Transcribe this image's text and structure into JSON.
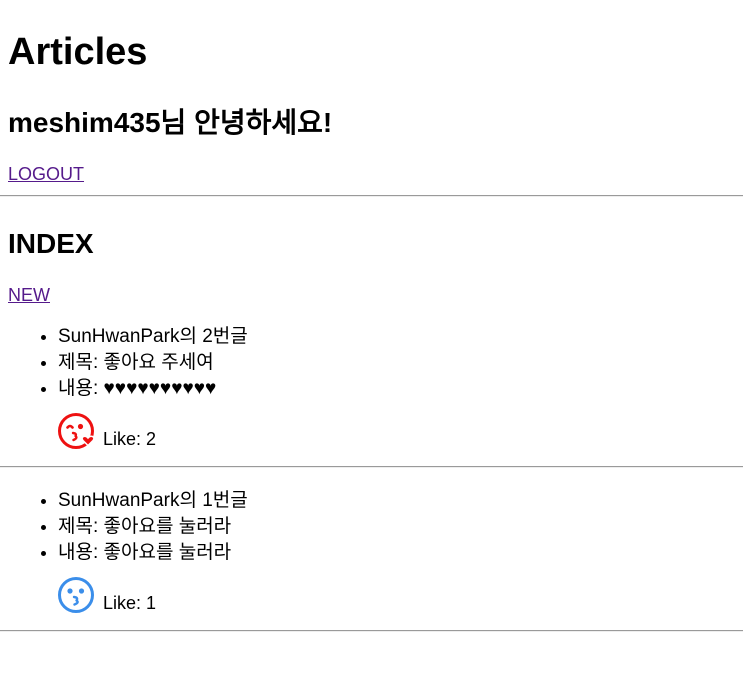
{
  "page": {
    "heading": "Articles"
  },
  "user": {
    "greeting": "meshim435님 안녕하세요!",
    "logout_label": "LOGOUT"
  },
  "index": {
    "title": "INDEX",
    "new_label": "NEW"
  },
  "articles": [
    {
      "header": "SunHwanPark의 2번글",
      "title_line": "제목: 좋아요 주세여",
      "content_line": "내용: ♥♥♥♥♥♥♥♥♥♥",
      "like_text": "Like: 2",
      "liked": true,
      "icon": "kiss-wink-heart-icon",
      "icon_color": "#ee1111"
    },
    {
      "header": "SunHwanPark의 1번글",
      "title_line": "제목: 좋아요를 눌러라",
      "content_line": "내용: 좋아요를 눌러라",
      "like_text": "Like: 1",
      "liked": false,
      "icon": "kiss-icon",
      "icon_color": "#3b8eea"
    }
  ]
}
